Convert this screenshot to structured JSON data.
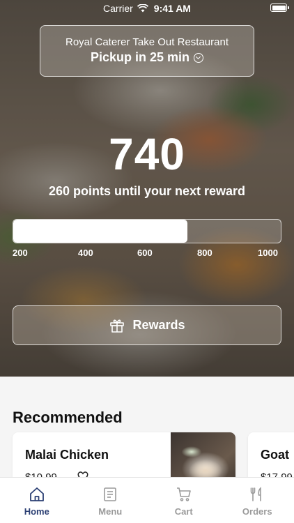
{
  "status_bar": {
    "carrier": "Carrier",
    "time": "9:41 AM"
  },
  "pickup": {
    "restaurant_name": "Royal Caterer Take Out Restaurant",
    "pickup_text": "Pickup in 25 min"
  },
  "rewards": {
    "points": "740",
    "caption": "260 points until your next reward",
    "progress_fraction": 0.65,
    "ticks": [
      "200",
      "400",
      "600",
      "800",
      "1000"
    ],
    "button_label": "Rewards"
  },
  "recommended": {
    "title": "Recommended",
    "items": [
      {
        "name": "Malai Chicken",
        "price": "$10.99"
      },
      {
        "name": "Goat",
        "price": "$17.99"
      }
    ]
  },
  "tabs": [
    {
      "label": "Home",
      "icon": "home-icon",
      "active": true
    },
    {
      "label": "Menu",
      "icon": "menu-icon",
      "active": false
    },
    {
      "label": "Cart",
      "icon": "cart-icon",
      "active": false
    },
    {
      "label": "Orders",
      "icon": "orders-icon",
      "active": false
    }
  ],
  "colors": {
    "accent": "#2b3f73",
    "inactive_tab": "#9a9a9a"
  }
}
